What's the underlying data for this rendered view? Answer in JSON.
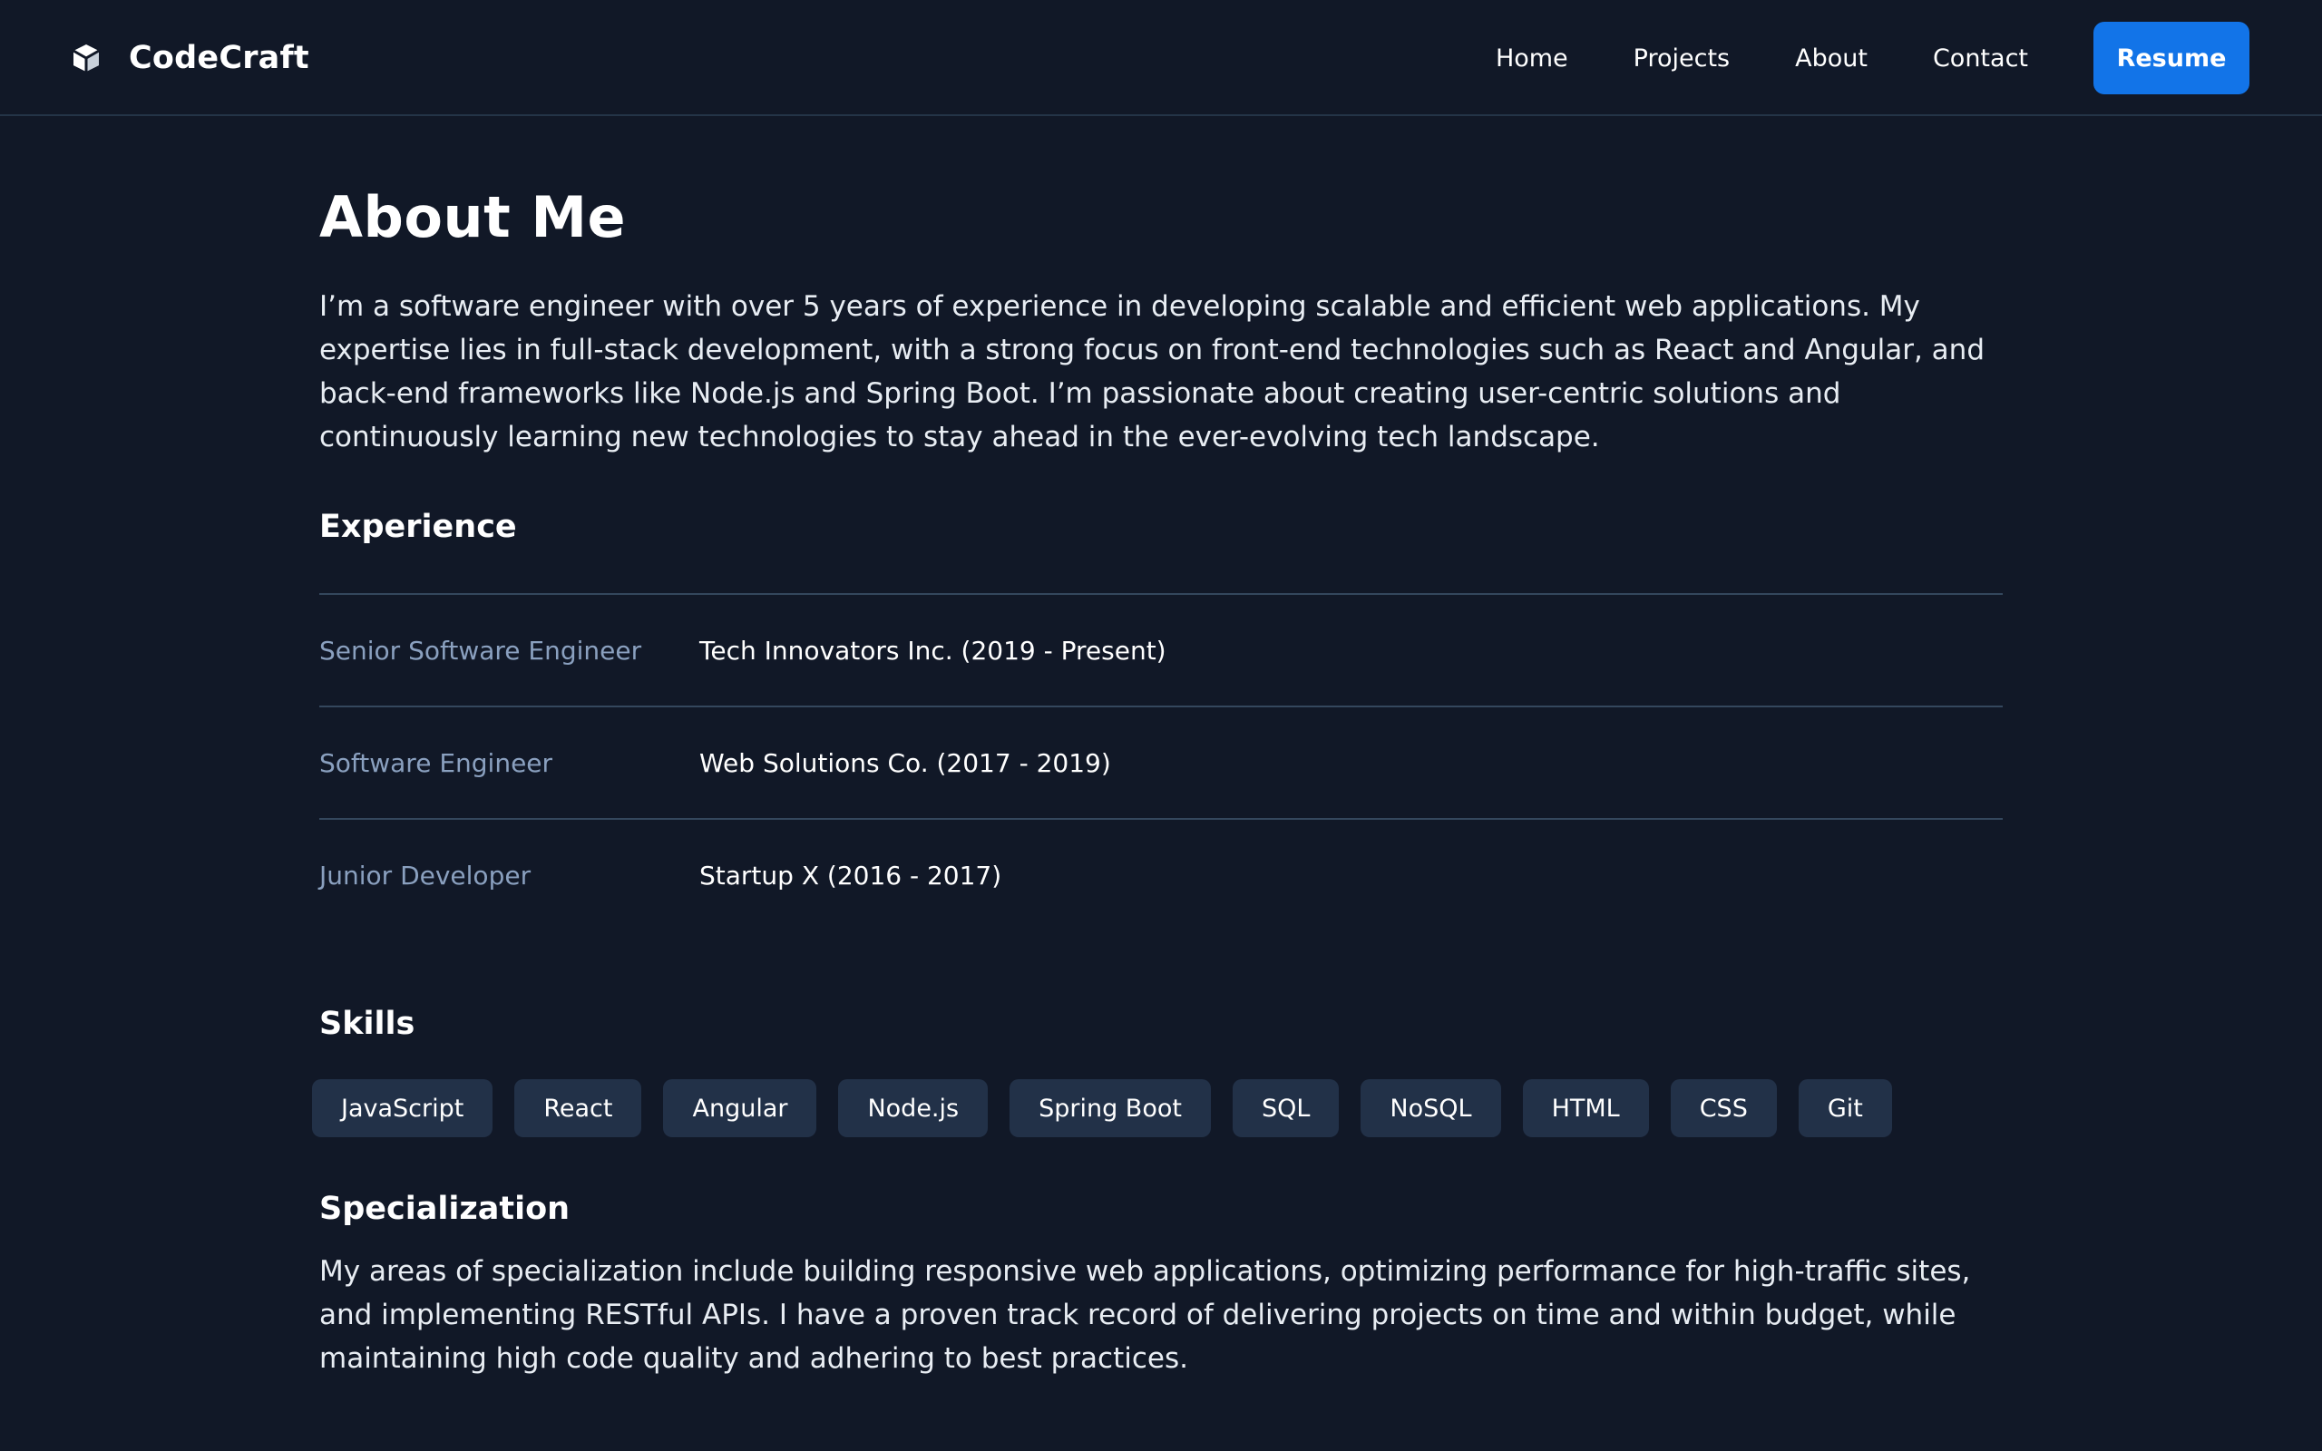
{
  "header": {
    "brand_name": "CodeCraft",
    "brand_icon": "cube-icon",
    "nav": [
      "Home",
      "Projects",
      "About",
      "Contact"
    ],
    "resume_label": "Resume"
  },
  "main": {
    "title": "About Me",
    "intro": "I’m a software engineer with over 5 years of experience in developing scalable and efficient web applications. My expertise lies in full-stack development, with a strong focus on front-end technologies such as React and Angular, and back-end frameworks like Node.js and Spring Boot. I’m passionate about creating user-centric solutions and continuously learning new technologies to stay ahead in the ever-evolving tech landscape.",
    "experience_heading": "Experience",
    "experience": [
      {
        "role": "Senior Software Engineer",
        "company": "Tech Innovators Inc. (2019 - Present)"
      },
      {
        "role": "Software Engineer",
        "company": "Web Solutions Co. (2017 - 2019)"
      },
      {
        "role": "Junior Developer",
        "company": "Startup X (2016 - 2017)"
      }
    ],
    "skills_heading": "Skills",
    "skills": [
      "JavaScript",
      "React",
      "Angular",
      "Node.js",
      "Spring Boot",
      "SQL",
      "NoSQL",
      "HTML",
      "CSS",
      "Git"
    ],
    "specialization_heading": "Specialization",
    "specialization": "My areas of specialization include building responsive web applications, optimizing performance for high-traffic sites, and implementing RESTful APIs. I have a proven track record of delivering projects on time and within budget, while maintaining high code quality and adhering to best practices."
  },
  "colors": {
    "background": "#111827",
    "accent": "#1274e8",
    "chip": "#223148",
    "muted_text": "#8aa0bf",
    "divider": "#34475d"
  }
}
